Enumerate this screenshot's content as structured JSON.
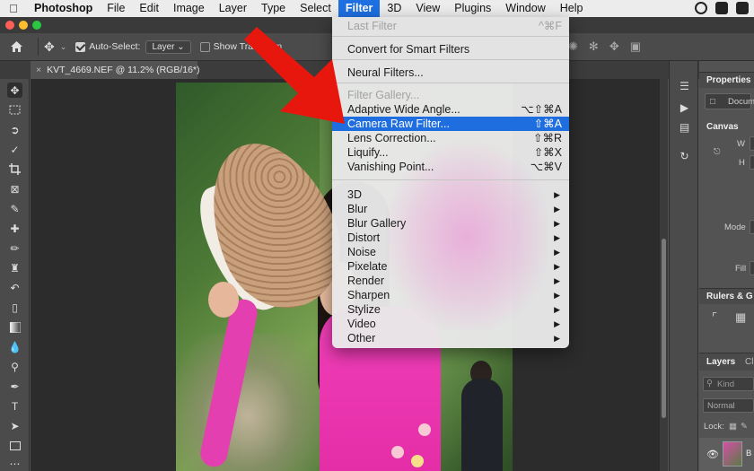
{
  "menubar": {
    "app_name": "Photoshop",
    "menus": [
      "File",
      "Edit",
      "Image",
      "Layer",
      "Type",
      "Select",
      "Filter",
      "3D",
      "View",
      "Plugins",
      "Window",
      "Help"
    ],
    "active_menu": "Filter"
  },
  "options_bar": {
    "auto_select_label": "Auto-Select:",
    "auto_select_value": "Layer",
    "show_transform_label": "Show Transform"
  },
  "document_tab": {
    "title": "KVT_4669.NEF @ 11.2% (RGB/16*)"
  },
  "filter_menu": {
    "items": [
      {
        "label": "Last Filter",
        "shortcut": "^⌘F",
        "disabled": true
      },
      {
        "label": "Convert for Smart Filters",
        "shortcut": ""
      },
      {
        "label": "Neural Filters...",
        "shortcut": ""
      },
      {
        "label": "Filter Gallery...",
        "shortcut": "",
        "disabled": true
      },
      {
        "label": "Adaptive Wide Angle...",
        "shortcut": "⌥⇧⌘A"
      },
      {
        "label": "Camera Raw Filter...",
        "shortcut": "⇧⌘A",
        "highlighted": true
      },
      {
        "label": "Lens Correction...",
        "shortcut": "⇧⌘R"
      },
      {
        "label": "Liquify...",
        "shortcut": "⇧⌘X"
      },
      {
        "label": "Vanishing Point...",
        "shortcut": "⌥⌘V"
      },
      {
        "label": "3D",
        "submenu": true
      },
      {
        "label": "Blur",
        "submenu": true
      },
      {
        "label": "Blur Gallery",
        "submenu": true
      },
      {
        "label": "Distort",
        "submenu": true
      },
      {
        "label": "Noise",
        "submenu": true
      },
      {
        "label": "Pixelate",
        "submenu": true
      },
      {
        "label": "Render",
        "submenu": true
      },
      {
        "label": "Sharpen",
        "submenu": true
      },
      {
        "label": "Stylize",
        "submenu": true
      },
      {
        "label": "Video",
        "submenu": true
      },
      {
        "label": "Other",
        "submenu": true
      }
    ],
    "submenu_arrow": "▶"
  },
  "right_panel": {
    "properties_title": "Properties",
    "document_label": "Docum",
    "canvas_section": "Canvas",
    "w_label": "W",
    "h_label": "H",
    "mode_label": "Mode",
    "fill_label": "Fill",
    "rulers_section": "Rulers & G",
    "layers_tab": "Layers",
    "channels_tab": "Cl",
    "kind_placeholder": "Kind",
    "blend_mode": "Normal",
    "lock_label": "Lock:",
    "layer_name": "B"
  },
  "colors": {
    "menu_highlight": "#1f6ee0",
    "arrow": "#e8170e"
  }
}
